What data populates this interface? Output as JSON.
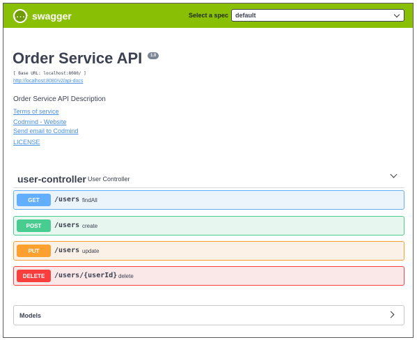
{
  "topbar": {
    "logo_icon": "{...}",
    "logo_text": "swagger",
    "spec_label": "Select a spec",
    "spec_value": "default",
    "color": "#89bf04"
  },
  "info": {
    "title": "Order Service API",
    "version": "1.0",
    "base_url": "[ Base URL: localhost:8080/ ]",
    "docs_link": "http://localhost:8080/v2/api-docs",
    "description": "Order Service API Description",
    "links": {
      "terms": "Terms of service",
      "website": "Codmind - Website",
      "email": "Send email to Codmind",
      "license": "LICENSE"
    }
  },
  "controller": {
    "name": "user-controller",
    "description": "User Controller",
    "operations": [
      {
        "method": "GET",
        "path": "/users",
        "summary": "findAll",
        "color": "#61affe"
      },
      {
        "method": "POST",
        "path": "/users",
        "summary": "create",
        "color": "#49cc90"
      },
      {
        "method": "PUT",
        "path": "/users",
        "summary": "update",
        "color": "#fca130"
      },
      {
        "method": "DELETE",
        "path": "/users/{userId}",
        "summary": "delete",
        "color": "#f93e3e"
      }
    ]
  },
  "models": {
    "label": "Models"
  }
}
